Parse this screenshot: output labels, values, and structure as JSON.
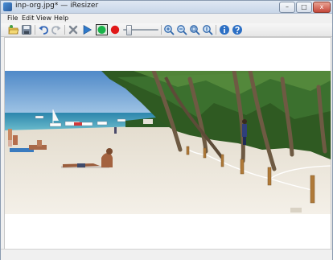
{
  "window": {
    "title": "inp-org.jpg* — iResizer",
    "minimize_label": "–",
    "maximize_label": "□",
    "close_label": "x"
  },
  "menu": {
    "items": [
      {
        "label": "File"
      },
      {
        "label": "Edit"
      },
      {
        "label": "View"
      },
      {
        "label": "Help"
      }
    ]
  },
  "toolbar": {
    "buttons": [
      {
        "name": "open-icon"
      },
      {
        "name": "save-icon"
      },
      {
        "name": "undo-icon"
      },
      {
        "name": "redo-icon"
      },
      {
        "name": "cancel-icon"
      },
      {
        "name": "play-icon"
      },
      {
        "name": "protect-marker-icon",
        "color": "#19b34a"
      },
      {
        "name": "remove-marker-icon",
        "color": "#e01818"
      },
      {
        "name": "zoom-in-icon"
      },
      {
        "name": "zoom-out-icon"
      },
      {
        "name": "zoom-fit-icon"
      },
      {
        "name": "zoom-actual-icon"
      },
      {
        "name": "info-icon"
      },
      {
        "name": "help-icon"
      }
    ]
  },
  "image": {
    "filename": "inp-org.jpg",
    "description_colors": {
      "sky": "#6a9fd2",
      "sea": "#2f8fb0",
      "sand": "#efe9dd",
      "palm": "#2f5a22"
    }
  }
}
